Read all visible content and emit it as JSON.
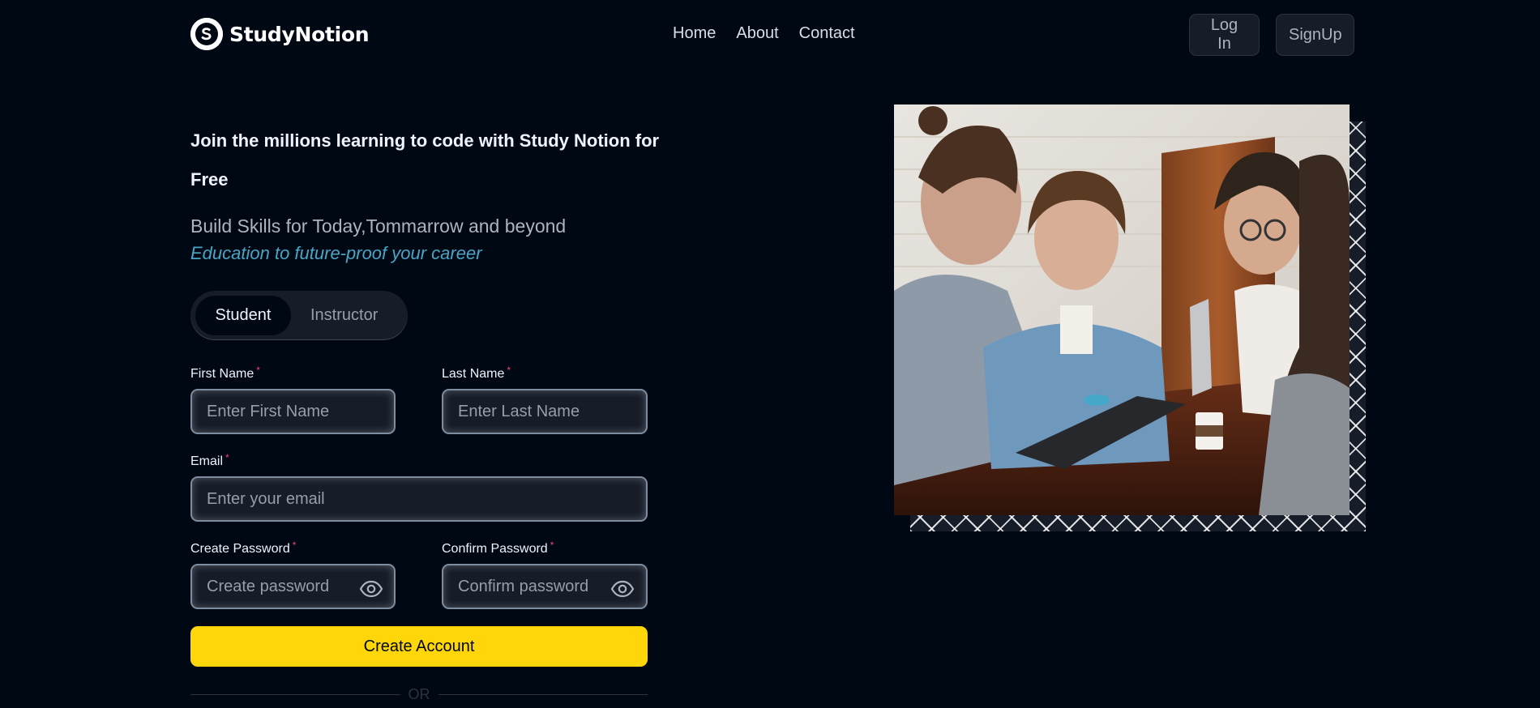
{
  "brand": {
    "name": "StudyNotion",
    "logo_letter": "S"
  },
  "nav": {
    "links": [
      "Home",
      "About",
      "Contact"
    ],
    "login_label": "Log In",
    "signup_label": "SignUp"
  },
  "hero": {
    "heading": "Join the millions learning to code with Study Notion for Free",
    "subtitle": "Build Skills for Today,Tommarrow and beyond",
    "tagline": "Education to future-proof your career"
  },
  "role_toggle": {
    "options": [
      "Student",
      "Instructor"
    ],
    "selected": "Student"
  },
  "form": {
    "first_name": {
      "label": "First Name",
      "placeholder": "Enter First Name",
      "value": ""
    },
    "last_name": {
      "label": "Last Name",
      "placeholder": "Enter Last Name",
      "value": ""
    },
    "email": {
      "label": "Email",
      "placeholder": "Enter your email",
      "value": ""
    },
    "create_password": {
      "label": "Create Password",
      "placeholder": "Create password",
      "value": ""
    },
    "confirm_password": {
      "label": "Confirm Password",
      "placeholder": "Confirm password",
      "value": ""
    },
    "required_marker": "*",
    "submit_label": "Create Account",
    "divider_text": "OR"
  },
  "icons": {
    "password_toggle": "eye-icon",
    "frame_pattern": "diagonal-cross-pattern"
  },
  "colors": {
    "background": "#000814",
    "accent_yellow": "#ffd60a",
    "tagline_blue": "#47a5c5",
    "required_red": "#ef476f",
    "input_bg": "#161d29"
  }
}
